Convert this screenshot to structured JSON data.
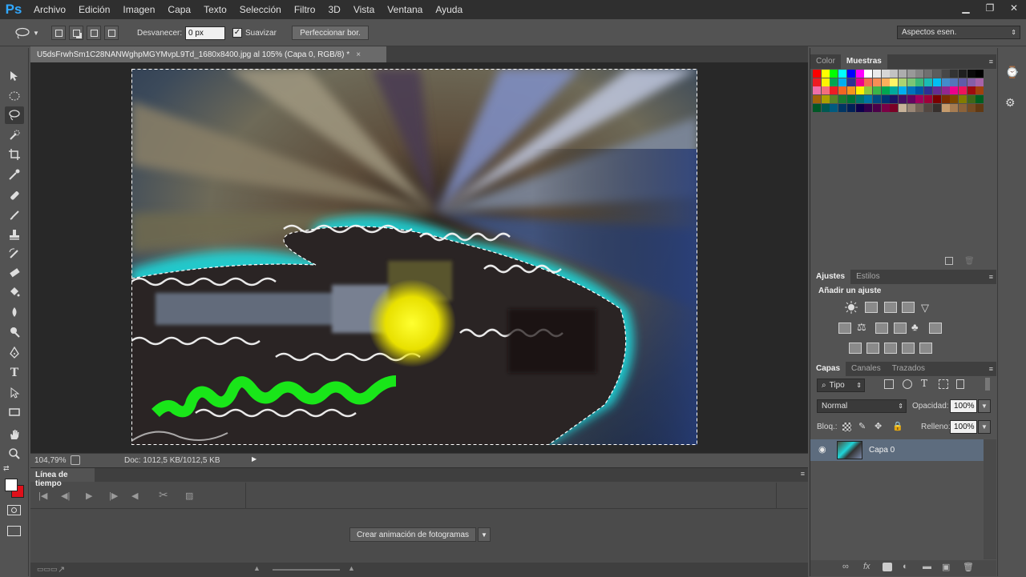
{
  "app": {
    "logo": "Ps",
    "menu": [
      "Archivo",
      "Edición",
      "Imagen",
      "Capa",
      "Texto",
      "Selección",
      "Filtro",
      "3D",
      "Vista",
      "Ventana",
      "Ayuda"
    ]
  },
  "options": {
    "feather_label": "Desvanecer:",
    "feather_value": "0 px",
    "antialias_label": "Suavizar",
    "antialias_checked": "✓",
    "refine_button": "Perfeccionar bor.",
    "workspace": "Aspectos esen."
  },
  "document": {
    "tab_title": "U5dsFrwhSm1C28NANWghpMGYMvpL9Td_1680x8400.jpg al 105% (Capa 0, RGB/8) *",
    "tab_close": "×",
    "zoom": "104,79%",
    "doc_info": "Doc: 1012,5 KB/1012,5 KB"
  },
  "timeline": {
    "tab": "Línea de tiempo",
    "create_button": "Crear animación de fotogramas"
  },
  "swatches_panel": {
    "tabs": [
      "Color",
      "Muestras"
    ],
    "active_tab": "Muestras",
    "colors": [
      "#ff0000",
      "#ffff00",
      "#00ff00",
      "#00ffff",
      "#0000ff",
      "#ff00ff",
      "#ffffff",
      "#ebebeb",
      "#d6d6d6",
      "#c2c2c2",
      "#adadad",
      "#999999",
      "#858585",
      "#707070",
      "#5c5c5c",
      "#474747",
      "#333333",
      "#1f1f1f",
      "#0a0a0a",
      "#000000",
      "#ed1c24",
      "#fff200",
      "#00a651",
      "#00aeef",
      "#2e3192",
      "#ec008c",
      "#f26c4f",
      "#f68e55",
      "#fbaf5c",
      "#fff467",
      "#acd372",
      "#7cc576",
      "#3bb878",
      "#1abbb4",
      "#00bff3",
      "#438ccb",
      "#5574b9",
      "#605ca8",
      "#855fa8",
      "#a763a8",
      "#f06ea9",
      "#f26d7d",
      "#ed1c24",
      "#f26522",
      "#f7941d",
      "#fff200",
      "#8dc73f",
      "#39b54a",
      "#00a651",
      "#00a99d",
      "#00aeef",
      "#0072bc",
      "#0054a6",
      "#2e3192",
      "#662d91",
      "#92278f",
      "#ec008c",
      "#ed145b",
      "#9e0b0f",
      "#a0410d",
      "#a36209",
      "#aba000",
      "#598527",
      "#1a7b30",
      "#007236",
      "#00746b",
      "#0076a3",
      "#004b80",
      "#003471",
      "#1b1464",
      "#440e62",
      "#630460",
      "#9e005d",
      "#9e0039",
      "#790000",
      "#7b2e00",
      "#7d4900",
      "#827b00",
      "#406618",
      "#005e20",
      "#005826",
      "#005952",
      "#005b7f",
      "#003663",
      "#002157",
      "#0d004c",
      "#32004b",
      "#4b0049",
      "#7b0046",
      "#7a0026",
      "#c7b299",
      "#998675",
      "#736357",
      "#534741",
      "#37302d",
      "#c69c6d",
      "#a67c52",
      "#8c6239",
      "#754c24",
      "#603913"
    ]
  },
  "adjustments_panel": {
    "tabs": [
      "Ajustes",
      "Estilos"
    ],
    "active_tab": "Ajustes",
    "title": "Añadir un ajuste"
  },
  "layers_panel": {
    "tabs": [
      "Capas",
      "Canales",
      "Trazados"
    ],
    "active_tab": "Capas",
    "filter": "Tipo",
    "blend_mode": "Normal",
    "opacity_label": "Opacidad:",
    "opacity_value": "100%",
    "lock_label": "Bloq.:",
    "fill_label": "Relleno:",
    "fill_value": "100%",
    "layers": [
      {
        "name": "Capa 0"
      }
    ]
  }
}
